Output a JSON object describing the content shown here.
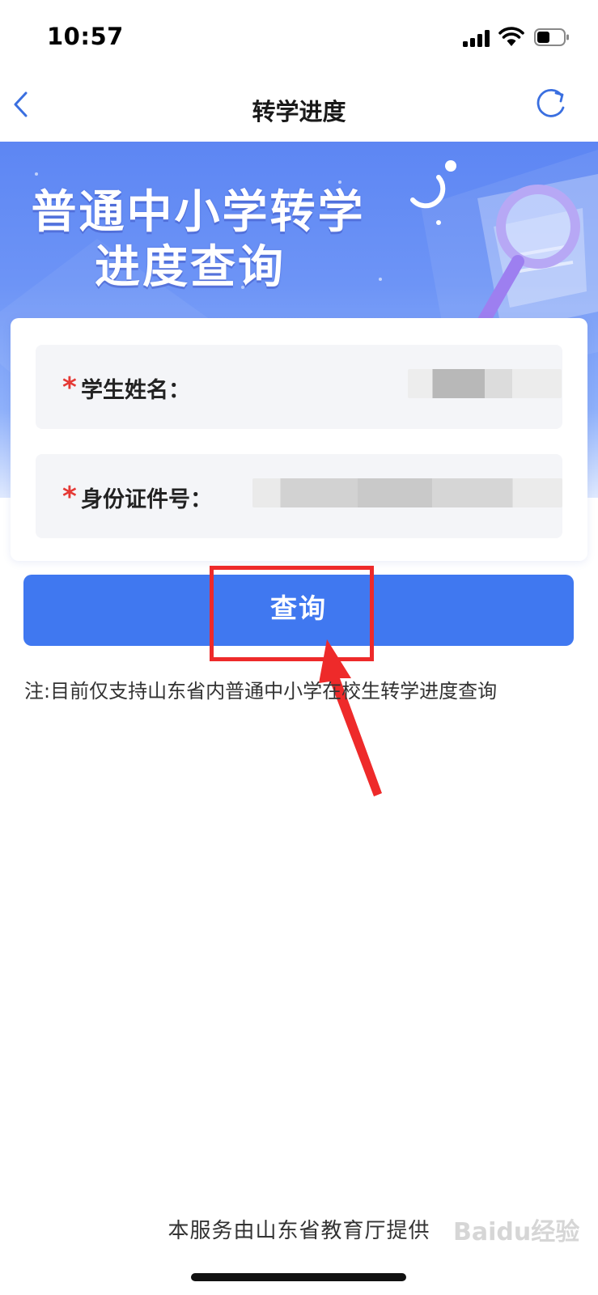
{
  "status_bar": {
    "time": "10:57"
  },
  "nav": {
    "title": "转学进度"
  },
  "banner": {
    "title_line1": "普通中小学转学",
    "title_line2": "进度查询"
  },
  "form": {
    "student_name_label": "学生姓名：",
    "id_number_label": "身份证件号：",
    "required_mark": "*"
  },
  "query_button_label": "查询",
  "note": "注:目前仅支持山东省内普通中小学在校生转学进度查询",
  "footer": "本服务由山东省教育厅提供",
  "watermark": "Baidu经验",
  "colors": {
    "accent": "#4078f0",
    "required": "#e53935",
    "annotation": "#ee2a2a"
  },
  "icons": [
    "signal-icon",
    "wifi-icon",
    "battery-icon",
    "back-icon",
    "refresh-icon",
    "magnifier-icon"
  ]
}
